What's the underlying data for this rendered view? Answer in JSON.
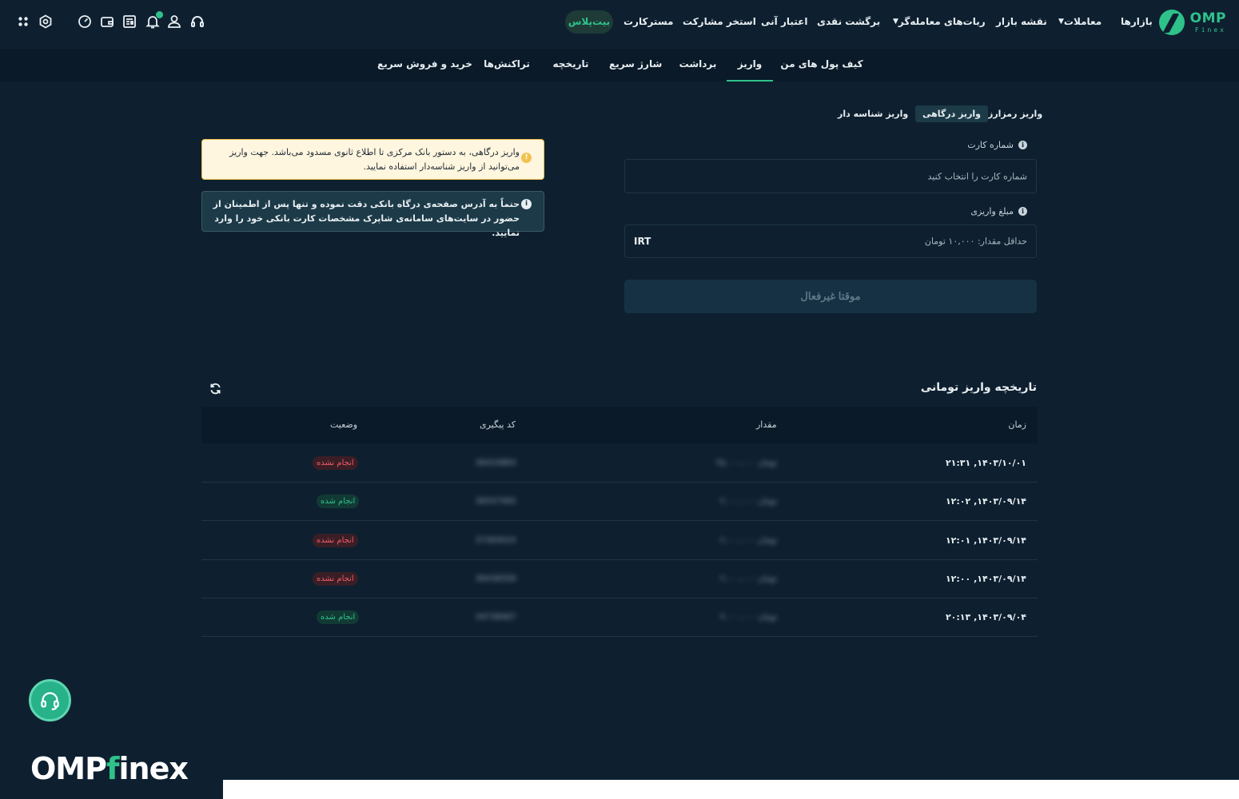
{
  "logo": {
    "brand": "OMP",
    "sub": "Finex"
  },
  "topnav": {
    "markets": "بازارها",
    "trades": "معاملات",
    "market_map": "نقشه بازار",
    "trading_bots": "ربات‌های معامله‌گر",
    "cash_back": "برگشت نقدی",
    "credit": "اعتبار آنی",
    "staking": "استخر مشارکت",
    "futures": "مستر‌کارت",
    "bitplus": "بیت‌پلاس"
  },
  "subnav": {
    "tabs": [
      "کیف پول های من",
      "واریز",
      "برداشت",
      "شارژ سریع",
      "تاریخچه",
      "تراکنش‌ها",
      "خرید و فروش سریع"
    ]
  },
  "deposit": {
    "tabs": [
      "واریز رمزارز",
      "واریز درگاهی",
      "واریز شناسه دار"
    ],
    "card_label": "شماره کارت",
    "card_placeholder": "شماره کارت را انتخاب کنید",
    "amount_label": "مبلغ واریزی",
    "amount_placeholder": "حداقل مقدار: ۱۰,۰۰۰ تومان",
    "amount_unit": "IRT",
    "submit_label": "موقتا غیرفعال"
  },
  "alerts": {
    "warning": "واریز درگاهی، به دستور بانک مرکزی تا اطلاع ثانوی مسدود می‌باشد. جهت واریز می‌توانید از واریز شناسه‌دار استفاده نمایید.",
    "info": "حتماً به آدرس صفحه‌ی درگاه بانکی دقت نموده و تنها پس از اطمینان از حضور در سایت‌های سامانه‌ی شاپرک مشخصات کارت بانکی خود را وارد نمایید."
  },
  "history": {
    "title": "تاریخچه واریز تومانی",
    "headers": {
      "time": "زمان",
      "amount": "مقدار",
      "code": "کد پیگیری",
      "status": "وضعیت"
    },
    "rows": [
      {
        "time": "۱۴۰۳/۱۰/۰۱, ۲۱:۳۱",
        "amount": "۲۵,۰۰۰,۰۰۰ تومان",
        "code": "36424864",
        "status": "انجام نشده",
        "ok": false
      },
      {
        "time": "۱۴۰۳/۰۹/۱۴, ۱۲:۰۲",
        "amount": "۲,۰۰۰,۰۰۰ تومان",
        "code": "36547465",
        "status": "انجام شده",
        "ok": true
      },
      {
        "time": "۱۴۰۳/۰۹/۱۴, ۱۲:۰۱",
        "amount": "۲,۰۰۰,۰۰۰ تومان",
        "code": "37364024",
        "status": "انجام نشده",
        "ok": false
      },
      {
        "time": "۱۴۰۳/۰۹/۱۴, ۱۲:۰۰",
        "amount": "۲,۰۰۰,۰۰۰ تومان",
        "code": "36436558",
        "status": "انجام نشده",
        "ok": false
      },
      {
        "time": "۱۴۰۳/۰۹/۰۴, ۲۰:۱۳",
        "amount": "۳,۰۰۰,۰۰۰ تومان",
        "code": "34738467",
        "status": "انجام شده",
        "ok": true
      }
    ]
  },
  "footer": {
    "brand_a": "OMP",
    "brand_f": "f",
    "brand_b": "inex"
  },
  "colors": {
    "accent": "#2ec28a",
    "fail": "#f05c6a",
    "background": "#0e2030"
  }
}
